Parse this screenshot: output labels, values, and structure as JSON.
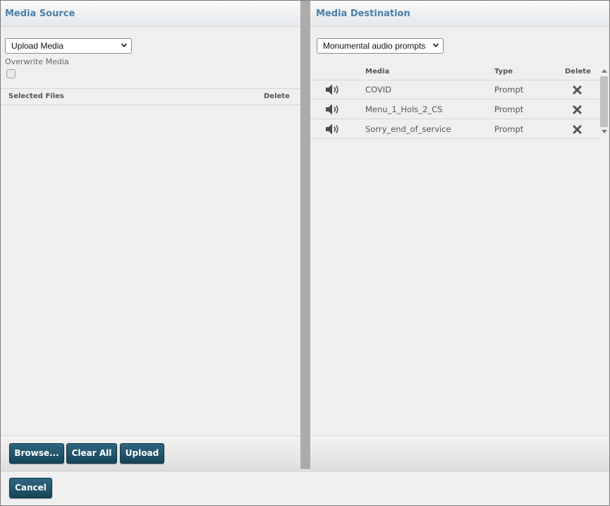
{
  "source": {
    "title": "Media Source",
    "select_value": "Upload Media",
    "overwrite_label": "Overwrite Media",
    "columns": {
      "files": "Selected Files",
      "delete": "Delete"
    },
    "buttons": {
      "browse": "Browse...",
      "clear_all": "Clear All",
      "upload": "Upload"
    }
  },
  "destination": {
    "title": "Media Destination",
    "select_value": "Monumental audio prompts",
    "columns": {
      "media": "Media",
      "type": "Type",
      "delete": "Delete"
    },
    "rows": [
      {
        "media": "COVID",
        "type": "Prompt"
      },
      {
        "media": "Menu_1_Hols_2_CS",
        "type": "Prompt"
      },
      {
        "media": "Sorry_end_of_service",
        "type": "Prompt"
      }
    ]
  },
  "footer": {
    "cancel": "Cancel"
  },
  "colors": {
    "accent_title": "#4a7fa8",
    "button": "#1f5268"
  },
  "icons": {
    "row_icon": "speaker-icon",
    "delete_icon": "x-icon",
    "select_icon": "chevron-down-icon"
  }
}
